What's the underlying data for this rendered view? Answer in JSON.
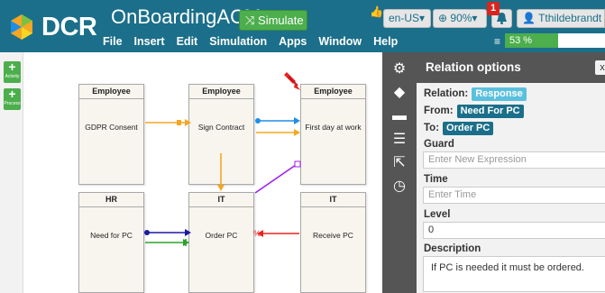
{
  "app": {
    "logo_text": "DCR",
    "title": "OnBoardingACM...",
    "simulate_label": "Simulate",
    "menu": [
      "File",
      "Insert",
      "Edit",
      "Simulation",
      "Apps",
      "Window",
      "Help"
    ],
    "lang_label": "en-US▾",
    "zoom_label": "90%▾",
    "notification_count": "1",
    "user_label": "Tthildebrandt",
    "progress_label": "53 %",
    "progress_value": 0.53
  },
  "tools": {
    "activity_label": "Activity",
    "process_label": "Process"
  },
  "graph": {
    "nodes": [
      {
        "role": "Employee",
        "name": "GDPR Consent"
      },
      {
        "role": "Employee",
        "name": "Sign Contract"
      },
      {
        "role": "Employee",
        "name": "First day at work"
      },
      {
        "role": "HR",
        "name": "Need for PC"
      },
      {
        "role": "IT",
        "name": "Order PC"
      },
      {
        "role": "IT",
        "name": "Receive PC"
      }
    ]
  },
  "panel": {
    "title": "Relation options",
    "close_label": "x",
    "relation_label": "Relation:",
    "relation_value": "Response",
    "from_label": "From:",
    "from_value": "Need For PC",
    "to_label": "To:",
    "to_value": "Order PC",
    "guard_label": "Guard",
    "guard_placeholder": "Enter New Expression",
    "time_label": "Time",
    "time_placeholder": "Enter Time",
    "level_label": "Level",
    "level_value": "0",
    "description_label": "Description",
    "description_value": "If PC is needed it must be ordered."
  },
  "colors": {
    "topbar": "#1b6f8a",
    "green": "#4cae4c",
    "orange": "#f5a623",
    "blue": "#1f8ee8",
    "purple": "#a020f0",
    "red": "#e8231e",
    "navy": "#1a1aa0",
    "green_arrow": "#2ca02c"
  }
}
